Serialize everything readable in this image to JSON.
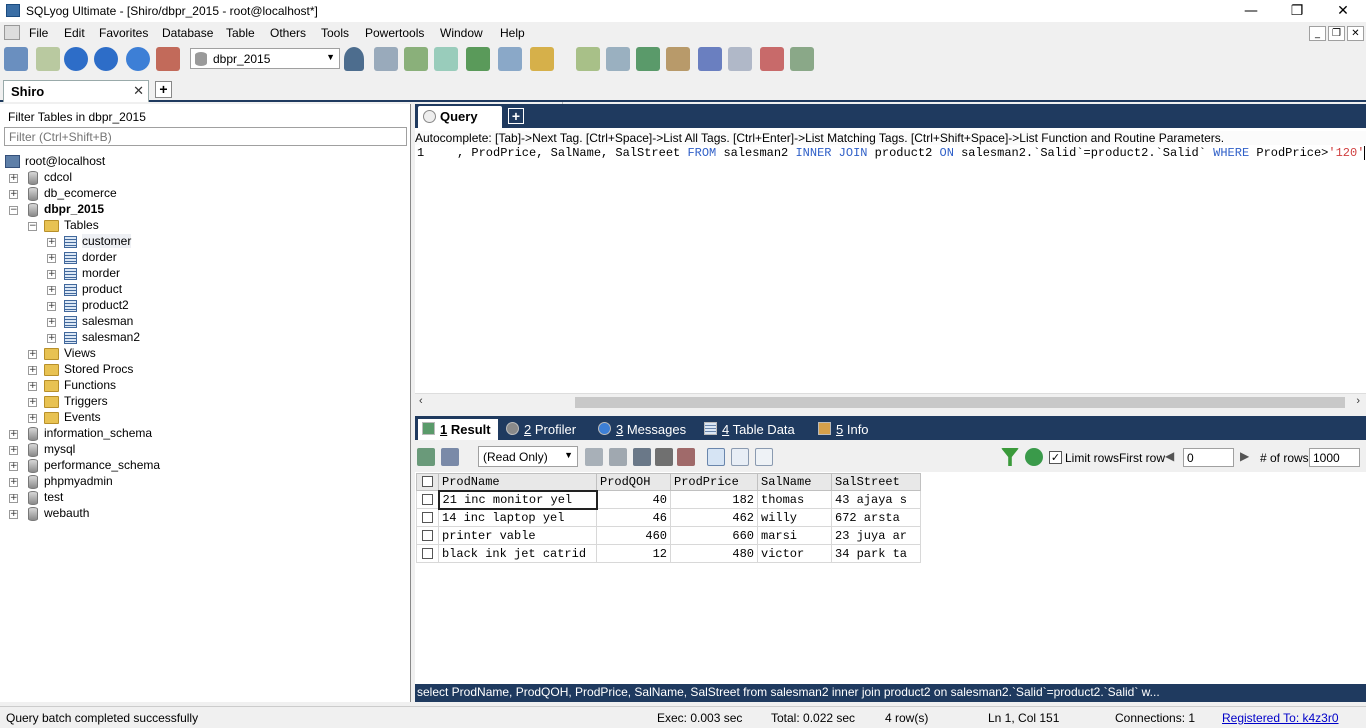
{
  "window": {
    "title": "SQLyog Ultimate - [Shiro/dbpr_2015 - root@localhost*]",
    "min": "—",
    "max": "❐",
    "close": "✕"
  },
  "menu": [
    "File",
    "Edit",
    "Favorites",
    "Database",
    "Table",
    "Others",
    "Tools",
    "Powertools",
    "Window",
    "Help"
  ],
  "toolbar": {
    "db_selected": "dbpr_2015"
  },
  "connection_tab": {
    "label": "Shiro",
    "close": "✕",
    "add": "+"
  },
  "object_browser": {
    "filter_label": "Filter Tables in dbpr_2015",
    "filter_placeholder": "Filter (Ctrl+Shift+B)",
    "server": "root@localhost",
    "databases_before": [
      "cdcol",
      "db_ecomerce"
    ],
    "open_db": "dbpr_2015",
    "tables_label": "Tables",
    "tables": [
      "customer",
      "dorder",
      "morder",
      "product",
      "product2",
      "salesman",
      "salesman2"
    ],
    "folders": [
      "Views",
      "Stored Procs",
      "Functions",
      "Triggers",
      "Events"
    ],
    "databases_after": [
      "information_schema",
      "mysql",
      "performance_schema",
      "phpmyadmin",
      "test",
      "webauth"
    ]
  },
  "query_tab": {
    "label": "Query",
    "add": "+"
  },
  "editor": {
    "autocomplete": "Autocomplete: [Tab]->Next Tag. [Ctrl+Space]->List All Tags. [Ctrl+Enter]->List Matching Tags. [Ctrl+Shift+Space]->List Function and Routine Parameters.",
    "line_number": "1",
    "code_a": ", ProdPrice, SalName, SalStreet ",
    "kw_from": "FROM",
    "code_b": " salesman2 ",
    "kw_inner": "INNER JOIN",
    "code_c": " product2 ",
    "kw_on": "ON",
    "code_d": " salesman2.`Salid`=product2.`Salid` ",
    "kw_where": "WHERE",
    "code_e": " ProdPrice>",
    "str_val": "'120'"
  },
  "result_tabs": [
    {
      "num": "1",
      "label": " Result"
    },
    {
      "num": "2",
      "label": " Profiler"
    },
    {
      "num": "3",
      "label": " Messages"
    },
    {
      "num": "4",
      "label": " Table Data"
    },
    {
      "num": "5",
      "label": " Info"
    }
  ],
  "result_toolbar": {
    "mode": "(Read Only)",
    "limit_rows": "Limit rows",
    "first_row_label": "First row",
    "first_row": "0",
    "num_rows_label": "# of rows",
    "num_rows": "1000"
  },
  "result_grid": {
    "columns": [
      "ProdName",
      "ProdQOH",
      "ProdPrice",
      "SalName",
      "SalStreet"
    ],
    "rows": [
      [
        "21 inc monitor yel",
        "40",
        "182",
        "thomas",
        "43 ajaya s"
      ],
      [
        "14 inc laptop yel",
        "46",
        "462",
        "willy",
        "672 arsta"
      ],
      [
        "printer vable",
        "460",
        "660",
        "marsi",
        "23 juya ar"
      ],
      [
        "black ink jet catrid",
        "12",
        "480",
        "victor",
        "34 park ta"
      ]
    ]
  },
  "sql_status": "select ProdName, ProdQOH, ProdPrice, SalName, SalStreet from salesman2 inner join product2 on salesman2.`Salid`=product2.`Salid` w...",
  "status_bar": {
    "message": "Query batch completed successfully",
    "exec": "Exec: 0.003 sec",
    "total": "Total: 0.022 sec",
    "rows": "4 row(s)",
    "position": "Ln 1, Col 151",
    "connections": "Connections: 1",
    "registered": "Registered To: k4z3r0"
  }
}
